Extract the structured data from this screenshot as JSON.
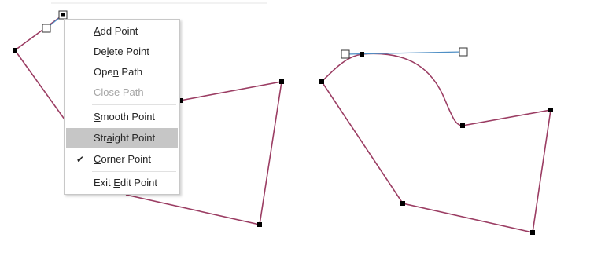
{
  "colors": {
    "path_stroke": "#9b3d63",
    "handle_line": "#4f8fc5",
    "menu_border": "#c8c8c8",
    "menu_highlight": "#c6c6c6",
    "disabled_text": "#a6a6a6"
  },
  "icons": {
    "check": "✔"
  },
  "context_menu": {
    "items": [
      {
        "pre": "",
        "accel": "A",
        "post": "dd Point",
        "state": "enabled",
        "checked": false
      },
      {
        "pre": "De",
        "accel": "l",
        "post": "ete Point",
        "state": "enabled",
        "checked": false
      },
      {
        "pre": "Ope",
        "accel": "n",
        "post": " Path",
        "state": "enabled",
        "checked": false
      },
      {
        "pre": "",
        "accel": "C",
        "post": "lose Path",
        "state": "disabled",
        "checked": false
      },
      {
        "pre": "",
        "accel": "S",
        "post": "mooth Point",
        "state": "enabled",
        "checked": false
      },
      {
        "pre": "Str",
        "accel": "a",
        "post": "ight Point",
        "state": "highlighted",
        "checked": false
      },
      {
        "pre": "",
        "accel": "C",
        "post": "orner Point",
        "state": "enabled",
        "checked": true
      },
      {
        "pre": "Exit ",
        "accel": "E",
        "post": "dit Point",
        "state": "enabled",
        "checked": false
      }
    ]
  }
}
